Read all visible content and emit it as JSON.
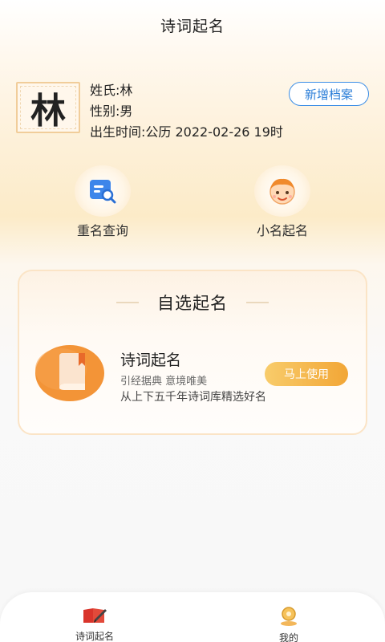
{
  "header": {
    "title": "诗词起名"
  },
  "profile": {
    "surname_char": "林",
    "surname_line": "姓氏:林",
    "gender_line": "性别:男",
    "birth_line": "出生时间:公历 2022-02-26 19时",
    "add_button": "新增档案"
  },
  "features": [
    {
      "label": "重名查询",
      "icon": "search-doc-icon"
    },
    {
      "label": "小名起名",
      "icon": "child-face-icon"
    }
  ],
  "card": {
    "heading": "自选起名",
    "item_title": "诗词起名",
    "subtitle_1": "引经据典 意境唯美",
    "subtitle_2": "从上下五千年诗词库精选好名",
    "use_button": "马上使用"
  },
  "tabs": [
    {
      "label": "诗词起名",
      "icon": "poem-book-icon",
      "active": true
    },
    {
      "label": "我的",
      "icon": "user-icon",
      "active": false
    }
  ],
  "colors": {
    "accent_blue": "#2d7fd8",
    "accent_orange": "#f2a636",
    "book_orange": "#ef8b2c"
  }
}
